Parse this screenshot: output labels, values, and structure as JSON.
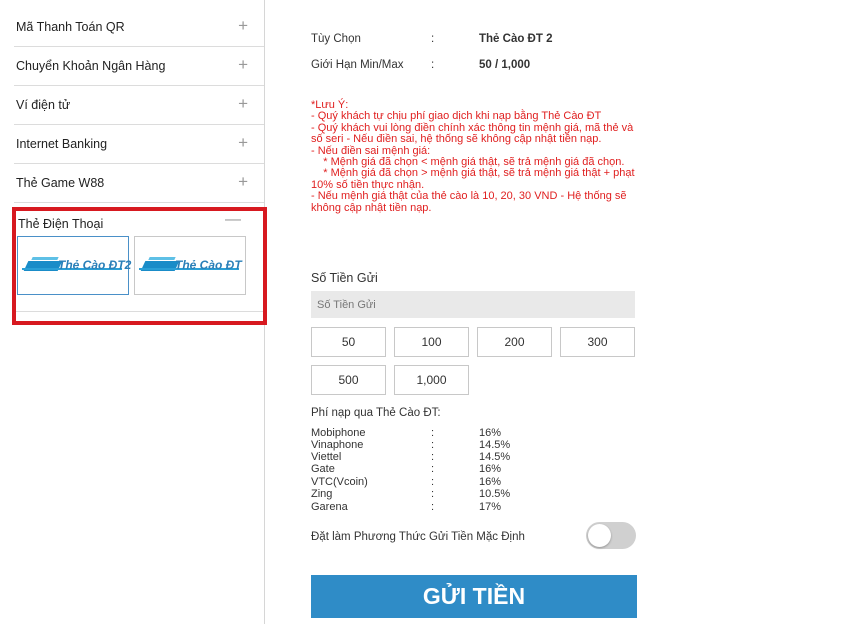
{
  "sidebar": {
    "items": [
      {
        "label": "Mã Thanh Toán QR",
        "icon": "+"
      },
      {
        "label": "Chuyển Khoản Ngân Hàng",
        "icon": "+"
      },
      {
        "label": "Ví điện tử",
        "icon": "+"
      },
      {
        "label": "Internet Banking",
        "icon": "+"
      },
      {
        "label": "Thẻ Game W88",
        "icon": "+"
      }
    ],
    "phone": {
      "label": "Thẻ Điện Thoại",
      "icon": "—",
      "cards": [
        {
          "label": "Thẻ Cào ĐT2",
          "selected": true
        },
        {
          "label": "Thẻ Cào ĐT",
          "selected": false
        }
      ]
    }
  },
  "main": {
    "option_key": "Tùy Chọn",
    "option_colon": ":",
    "option_value": "Thẻ Cào ĐT 2",
    "limit_key": "Giới Hạn Min/Max",
    "limit_colon": ":",
    "limit_value": "50 / 1,000",
    "note": [
      "*Lưu Ý:",
      "- Quý khách tự chịu phí giao dịch khi nạp bằng Thẻ Cào ĐT",
      "- Quý khách vui lòng điền chính xác thông tin mệnh giá, mã thẻ và số seri - Nếu điền sai, hệ thống sẽ không cập nhật tiền nạp.",
      "- Nếu điền sai mệnh giá:",
      "    * Mệnh giá đã chọn < mệnh giá thật, sẽ trả mệnh giá đã chọn.",
      "    * Mệnh giá đã chọn > mệnh giá thật, sẽ trả mệnh giá thật + phạt 10% số tiền thực nhận.",
      "- Nếu mệnh giá thật của thẻ cào là 10, 20, 30 VND - Hệ thống sẽ không cập nhật tiền nạp."
    ],
    "amount_title": "Số Tiền Gửi",
    "amount_placeholder": "Số Tiền Gửi",
    "amounts": [
      "50",
      "100",
      "200",
      "300",
      "500",
      "1,000"
    ],
    "fee_title": "Phí nạp qua Thẻ Cào ĐT:",
    "fees": [
      {
        "name": "Mobiphone",
        "colon": ":",
        "pct": "16%"
      },
      {
        "name": "Vinaphone",
        "colon": ":",
        "pct": "14.5%"
      },
      {
        "name": "Viettel",
        "colon": ":",
        "pct": "14.5%"
      },
      {
        "name": "Gate",
        "colon": ":",
        "pct": "16%"
      },
      {
        "name": "VTC(Vcoin)",
        "colon": ":",
        "pct": "16%"
      },
      {
        "name": "Zing",
        "colon": ":",
        "pct": "10.5%"
      },
      {
        "name": "Garena",
        "colon": ":",
        "pct": "17%"
      }
    ],
    "default_label": "Đặt làm Phương Thức Gửi Tiền Mặc Định",
    "default_on": false,
    "submit_label": "GỬI TIỀN"
  },
  "colors": {
    "highlight": "#d71920",
    "primary": "#2f8cc7",
    "note": "#e02020"
  }
}
